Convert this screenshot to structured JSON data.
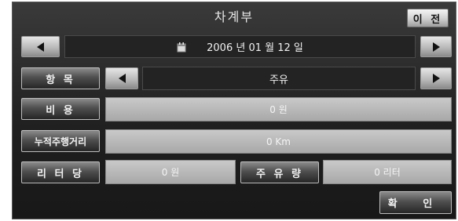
{
  "header": {
    "title": "차계부",
    "prev_label": "이 전"
  },
  "date": {
    "text": "2006 년 01 월 12 일",
    "icon": "calendar-icon"
  },
  "item": {
    "label": "항 목",
    "value": "주유"
  },
  "cost": {
    "label": "비 용",
    "value": "0 원"
  },
  "mileage": {
    "label": "누적주행거리",
    "value": "0 Km"
  },
  "per_liter": {
    "label": "리 터 당",
    "value": "0 원"
  },
  "fuel_amount": {
    "label": "주 유 량",
    "value": "0 리터"
  },
  "footer": {
    "confirm_label": "확 인"
  }
}
